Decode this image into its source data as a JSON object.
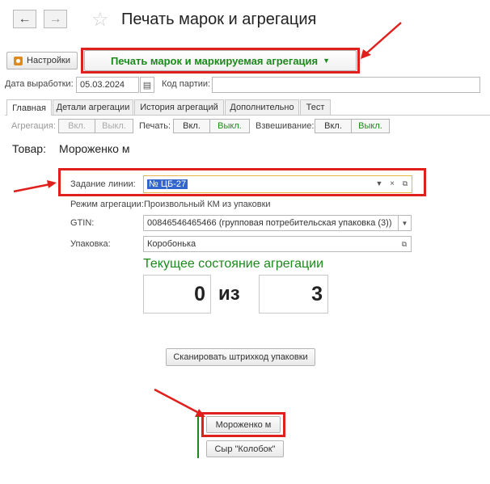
{
  "nav": {
    "back_icon": "arrow-left-icon",
    "forward_icon": "arrow-right-icon",
    "favorite_icon": "star-icon"
  },
  "window": {
    "title": "Печать марок и агрегация"
  },
  "toolbar": {
    "settings_label": "Настройки",
    "main_command_label": "Печать марок и маркируемая агрегация"
  },
  "header": {
    "production_date_label": "Дата выработки:",
    "production_date_value": "05.03.2024",
    "batch_code_label": "Код партии:",
    "batch_code_value": ""
  },
  "tabs": [
    {
      "label": "Главная"
    },
    {
      "label": "Детали агрегации"
    },
    {
      "label": "История агрегаций"
    },
    {
      "label": "Дополнительно"
    },
    {
      "label": "Тест"
    }
  ],
  "toggles": {
    "aggregation_label": "Агрегация:",
    "print_label": "Печать:",
    "weighing_label": "Взвешивание:",
    "on": "Вкл.",
    "off": "Выкл."
  },
  "product": {
    "label": "Товар:",
    "value": "Мороженко м"
  },
  "form": {
    "line_task_label": "Задание линии:",
    "line_task_value": "№ ЦБ-27",
    "mode_label": "Режим агрегации:",
    "mode_value": "Произвольный КМ из упаковки",
    "gtin_label": "GTIN:",
    "gtin_value": "00846546465466 (групповая потребительская упаковка (3))",
    "package_label": "Упаковка:",
    "package_value": "Коробонька"
  },
  "state": {
    "title": "Текущее состояние агрегации",
    "current": "0",
    "separator": "из",
    "total": "3"
  },
  "actions": {
    "scan_label": "Сканировать штрихкод упаковки",
    "products": [
      {
        "label": "Мороженко м"
      },
      {
        "label": "Сыр \"Колобок\""
      }
    ]
  },
  "colors": {
    "accent_green": "#1b8a1b",
    "highlight_red": "#e0201c",
    "selection_blue": "#3366cc"
  }
}
